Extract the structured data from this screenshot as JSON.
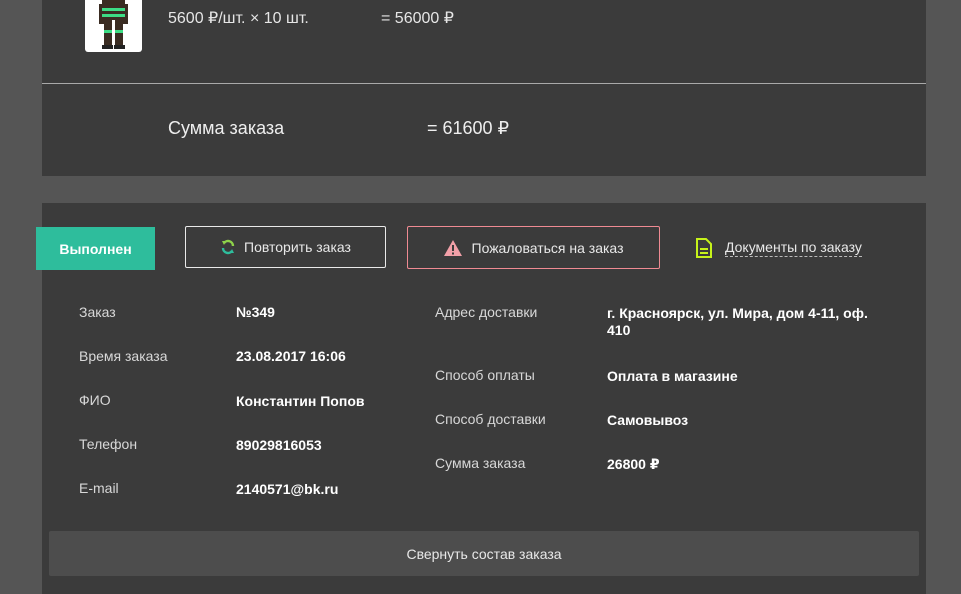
{
  "item": {
    "price_per_unit": "5600 ₽/шт. × 10 шт.",
    "line_total": "= 56000 ₽"
  },
  "order_sum": {
    "label": "Сумма заказа",
    "value": "= 61600 ₽"
  },
  "actions": {
    "status": "Выполнен",
    "repeat": "Повторить заказ",
    "complain": "Пожаловаться на заказ",
    "documents": "Документы по заказу"
  },
  "details_left": [
    {
      "label": "Заказ",
      "value": "№349"
    },
    {
      "label": "Время заказа",
      "value": "23.08.2017 16:06"
    },
    {
      "label": "ФИО",
      "value": "Константин Попов"
    },
    {
      "label": "Телефон",
      "value": "89029816053"
    },
    {
      "label": "E-mail",
      "value": "2140571@bk.ru"
    }
  ],
  "details_right": [
    {
      "label": "Адрес доставки",
      "value": "г. Красноярск, ул. Мира, дом 4-11, оф. 410"
    },
    {
      "label": "Способ оплаты",
      "value": "Оплата в магазине"
    },
    {
      "label": "Способ доставки",
      "value": "Самовывоз"
    },
    {
      "label": "Сумма заказа",
      "value": "26800 ₽"
    }
  ],
  "collapse_label": "Свернуть состав заказа",
  "colors": {
    "status": "#2ebd9c",
    "complain_border": "#ef8a92",
    "warning_icon": "#f2a0a8",
    "docs_icon": "#c6f21a",
    "repeat_icon": "#8ed24a"
  },
  "icons": {
    "repeat": "refresh-icon",
    "complain": "warning-icon",
    "documents": "document-icon"
  }
}
